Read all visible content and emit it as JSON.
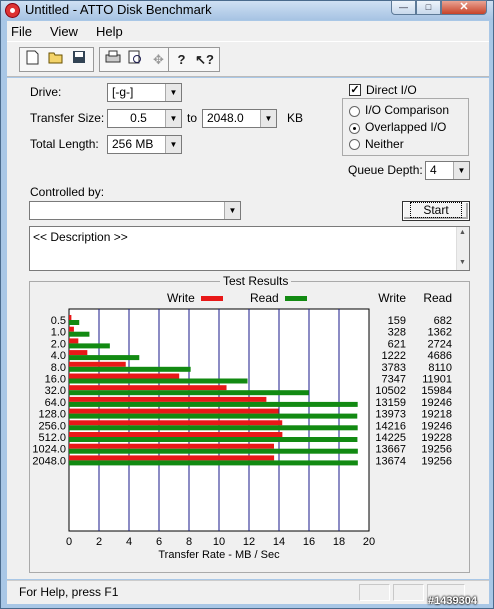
{
  "window": {
    "title": "Untitled - ATTO Disk Benchmark",
    "minimize": "—",
    "maximize": "□",
    "close": "✕"
  },
  "menu": {
    "file": "File",
    "view": "View",
    "help": "Help"
  },
  "toolbar": {
    "icons": [
      "new-document-icon",
      "open-folder-icon",
      "save-icon",
      "print-icon",
      "print-preview-icon",
      "move-icon",
      "help-icon",
      "context-help-icon"
    ]
  },
  "form": {
    "drive_label": "Drive:",
    "drive_value": "[-g-]",
    "transfer_size_label": "Transfer Size:",
    "transfer_from": "0.5",
    "to_label": "to",
    "transfer_to": "2048.0",
    "kb_label": "KB",
    "total_length_label": "Total Length:",
    "total_length_value": "256 MB",
    "direct_io_label": "Direct I/O",
    "direct_io_checked": true,
    "io_comparison_label": "I/O Comparison",
    "overlapped_io_label": "Overlapped I/O",
    "neither_label": "Neither",
    "selected_mode": "Overlapped I/O",
    "queue_depth_label": "Queue Depth:",
    "queue_depth_value": "4",
    "controlled_by_label": "Controlled by:",
    "controlled_by_value": "",
    "start_label": "Start",
    "description": "<< Description >>"
  },
  "results": {
    "title": "Test Results",
    "write_legend": "Write",
    "read_legend": "Read",
    "write_col": "Write",
    "read_col": "Read"
  },
  "chart_data": {
    "type": "bar",
    "orientation": "horizontal",
    "categories": [
      "0.5",
      "1.0",
      "2.0",
      "4.0",
      "8.0",
      "16.0",
      "32.0",
      "64.0",
      "128.0",
      "256.0",
      "512.0",
      "1024.0",
      "2048.0"
    ],
    "series": [
      {
        "name": "Write",
        "color": "#e81818",
        "values": [
          159,
          328,
          621,
          1222,
          3783,
          7347,
          10502,
          13159,
          13973,
          14216,
          14225,
          13667,
          13674
        ]
      },
      {
        "name": "Read",
        "color": "#128a12",
        "values": [
          682,
          1362,
          2724,
          4686,
          8110,
          11901,
          15984,
          19246,
          19218,
          19246,
          19228,
          19256,
          19256
        ]
      }
    ],
    "xlabel": "Transfer Rate - MB / Sec",
    "xlim": [
      0,
      20
    ],
    "xticks": [
      0,
      2,
      4,
      6,
      8,
      10,
      12,
      14,
      16,
      18,
      20
    ],
    "grid": true,
    "legend": "top"
  },
  "status": {
    "text": "For Help, press F1"
  },
  "watermark": "#1439304"
}
